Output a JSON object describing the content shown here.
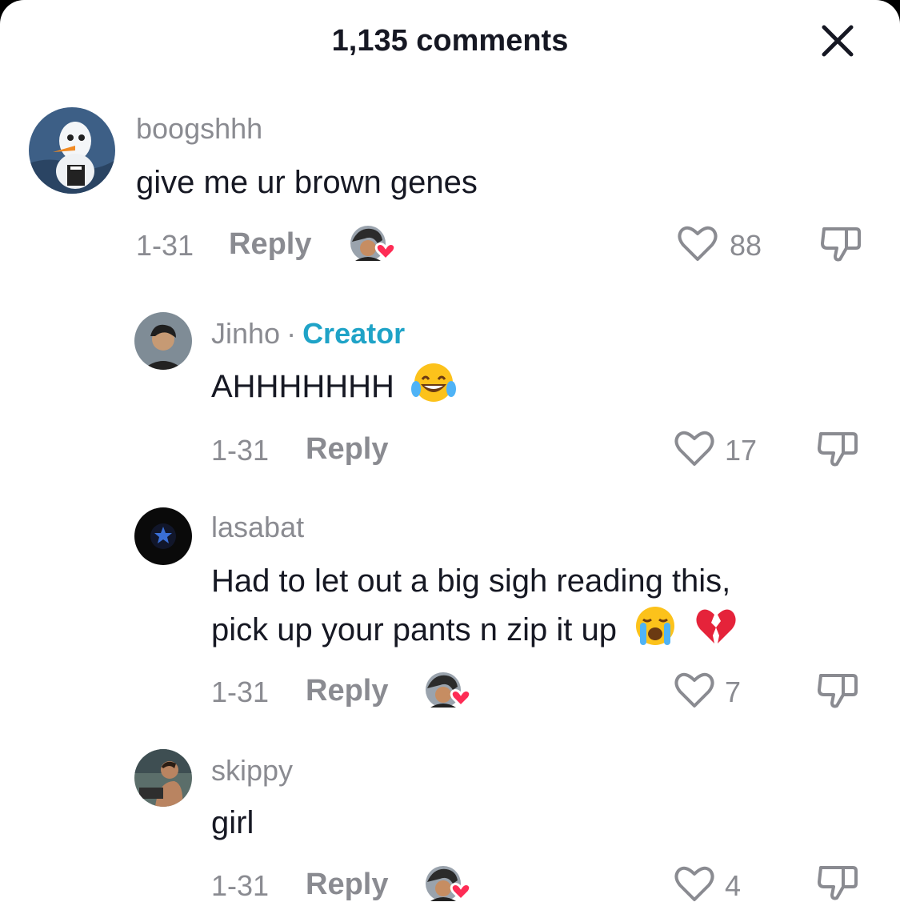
{
  "header": {
    "title": "1,135 comments",
    "close_icon": "close-icon"
  },
  "comments": [
    {
      "username": "boogshhh",
      "text": "give me ur brown genes",
      "date": "1-31",
      "reply_label": "Reply",
      "likes": "88",
      "liked_by_creator": true
    },
    {
      "username": "Jinho",
      "separator": "·",
      "creator_label": "Creator",
      "text": "AHHHHHHH",
      "emoji": [
        "face-with-tears-of-joy"
      ],
      "date": "1-31",
      "reply_label": "Reply",
      "likes": "17",
      "liked_by_creator": false
    },
    {
      "username": "lasabat",
      "text_lines": [
        "Had to let out a big sigh reading this,",
        "pick up your pants n zip it up"
      ],
      "emoji": [
        "loudly-crying-face",
        "broken-heart"
      ],
      "date": "1-31",
      "reply_label": "Reply",
      "likes": "7",
      "liked_by_creator": true
    },
    {
      "username": "skippy",
      "text": "girl",
      "date": "1-31",
      "reply_label": "Reply",
      "likes": "4",
      "liked_by_creator": true
    }
  ],
  "colors": {
    "text": "#161823",
    "secondary": "#8a8b91",
    "creator": "#1fa3c7",
    "heart_badge": "#fe2c55"
  }
}
